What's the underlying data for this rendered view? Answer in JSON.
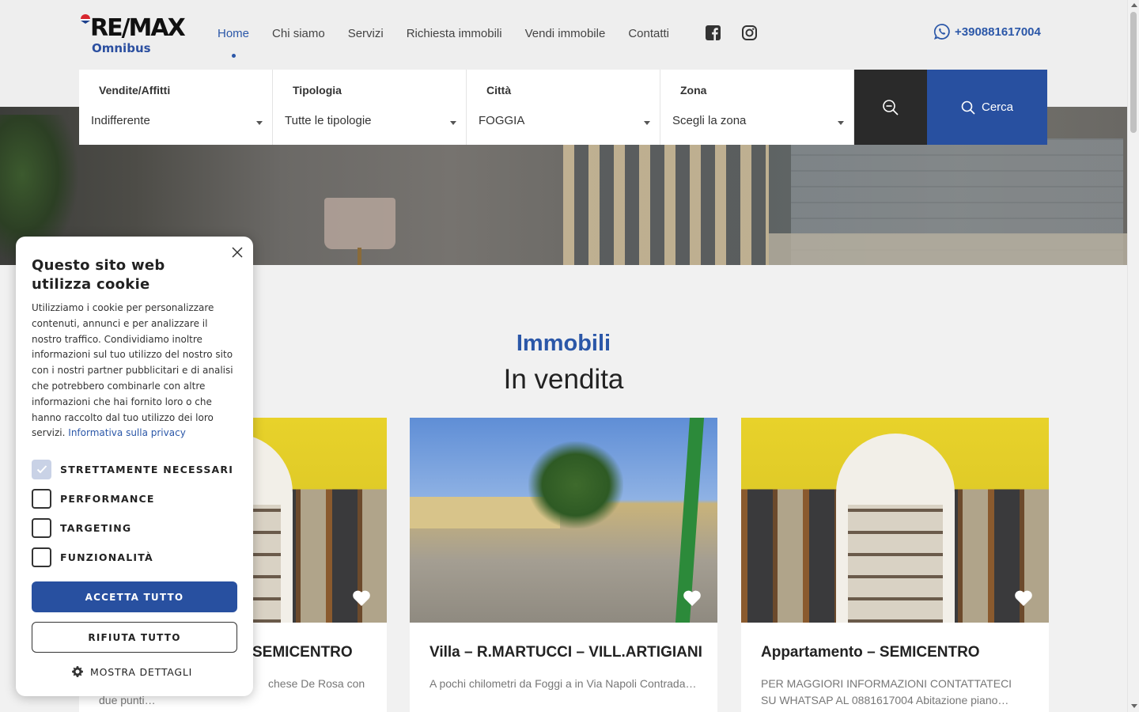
{
  "brand": {
    "logo_text": "RE/MAX",
    "logo_sub": "Omnibus"
  },
  "nav": {
    "items": [
      {
        "label": "Home",
        "active": true
      },
      {
        "label": "Chi siamo"
      },
      {
        "label": "Servizi"
      },
      {
        "label": "Richiesta immobili"
      },
      {
        "label": "Vendi immobile"
      },
      {
        "label": "Contatti"
      }
    ],
    "social": [
      "facebook-icon",
      "instagram-icon"
    ],
    "phone": "+390881617004"
  },
  "search": {
    "fields": [
      {
        "label": "Vendite/Affitti",
        "value": "Indifferente"
      },
      {
        "label": "Tipologia",
        "value": "Tutte le tipologie"
      },
      {
        "label": "Città",
        "value": "FOGGIA"
      },
      {
        "label": "Zona",
        "value": "Scegli la zona"
      }
    ],
    "button_label": "Cerca"
  },
  "section": {
    "eyebrow": "Immobili",
    "title": "In vendita"
  },
  "listings": [
    {
      "title": "Appartamento – SEMICENTRO",
      "desc": "Zona Via Marchese De Rosa con due punti…",
      "visible_title": "SEMICENTRO",
      "visible_desc": "chese De Rosa con",
      "visible_desc2": "due punti…"
    },
    {
      "title": "Villa – R.MARTUCCI – VILL.ARTIGIANI",
      "desc": "A pochi chilometri da Foggi a in Via Napoli Contrada…"
    },
    {
      "title": "Appartamento – SEMICENTRO",
      "desc": "PER MAGGIORI INFORMAZIONI CONTATTATECI SU WHATSAP AL 0881617004 Abitazione piano…"
    }
  ],
  "cookie": {
    "title": "Questo sito web utilizza cookie",
    "body": "Utilizziamo i cookie per personalizzare contenuti, annunci e per analizzare il nostro traffico. Condividiamo inoltre informazioni sul tuo utilizzo del nostro sito con i nostri partner pubblicitari e di analisi che potrebbero combinarle con altre informazioni che hai fornito loro o che hanno raccolto dal tuo utilizzo dei loro servizi.",
    "privacy_link": "Informativa sulla privacy",
    "options": [
      {
        "label": "STRETTAMENTE NECESSARI",
        "checked": true
      },
      {
        "label": "PERFORMANCE",
        "checked": false
      },
      {
        "label": "TARGETING",
        "checked": false
      },
      {
        "label": "FUNZIONALITÀ",
        "checked": false
      }
    ],
    "accept_label": "ACCETTA TUTTO",
    "reject_label": "RIFIUTA TUTTO",
    "details_label": "MOSTRA DETTAGLI"
  },
  "colors": {
    "brand_blue": "#2850a0",
    "dark_button": "#2a2a2a"
  }
}
